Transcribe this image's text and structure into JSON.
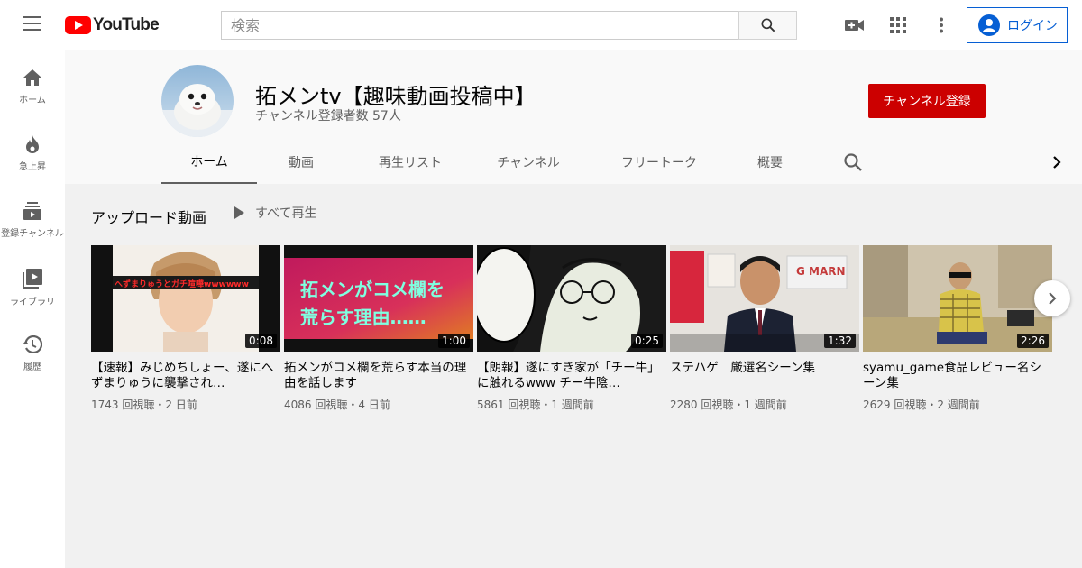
{
  "header": {
    "logo_text": "YouTube",
    "search_placeholder": "検索",
    "login_label": "ログイン",
    "icons": [
      "menu-icon",
      "search-icon",
      "video-camera-icon",
      "apps-icon",
      "more-vert-icon",
      "account-icon"
    ]
  },
  "sidebar": {
    "items": [
      {
        "label": "ホーム",
        "icon": "home-icon"
      },
      {
        "label": "急上昇",
        "icon": "fire-icon"
      },
      {
        "label": "登録チャンネル",
        "icon": "subscriptions-icon"
      },
      {
        "label": "ライブラリ",
        "icon": "library-icon"
      },
      {
        "label": "履歴",
        "icon": "history-icon"
      }
    ]
  },
  "channel": {
    "title": "拓メンtv【趣味動画投稿中】",
    "subscribers": "チャンネル登録者数 57人",
    "subscribe_label": "チャンネル登録",
    "tabs": [
      {
        "label": "ホーム",
        "active": true
      },
      {
        "label": "動画",
        "active": false
      },
      {
        "label": "再生リスト",
        "active": false
      },
      {
        "label": "チャンネル",
        "active": false
      },
      {
        "label": "フリートーク",
        "active": false
      },
      {
        "label": "概要",
        "active": false
      }
    ]
  },
  "section": {
    "title": "アップロード動画",
    "play_all_label": "すべて再生"
  },
  "videos": [
    {
      "title": "【速報】みじめちしょー、遂にへずまりゅうに襲撃され…",
      "duration": "0:08",
      "meta": "1743 回視聴・2 日前",
      "thumb_text": "へずまりゅうとガチ喧嘩wwwwww"
    },
    {
      "title": "拓メンがコメ欄を荒らす本当の理由を話します",
      "duration": "1:00",
      "meta": "4086 回視聴・4 日前",
      "thumb_line1": "拓メンがコメ欄を",
      "thumb_line2": "荒らす理由……"
    },
    {
      "title": "【朗報】遂にすき家が「チー牛」に触れるwww チー牛陰…",
      "duration": "0:25",
      "meta": "5861 回視聴・1 週間前"
    },
    {
      "title": "ステハゲ　厳選名シーン集",
      "duration": "1:32",
      "meta": "2280 回視聴・1 週間前",
      "thumb_sign": "G MARN"
    },
    {
      "title": "syamu_game食品レビュー名シーン集",
      "duration": "2:26",
      "meta": "2629 回視聴・2 週間前"
    }
  ],
  "colors": {
    "brand_red": "#ff0000",
    "subscribe_red": "#cc0000",
    "link_blue": "#065fd4"
  }
}
